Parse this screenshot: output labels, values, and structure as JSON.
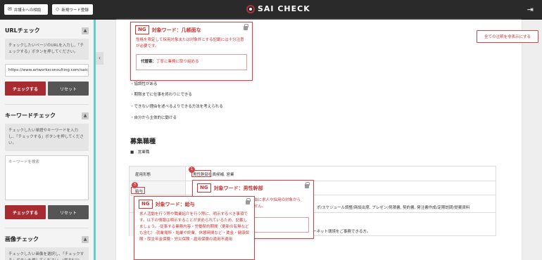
{
  "topbar": {
    "consult_label": "弁護士への相談",
    "new_word_label": "新規ワード登録",
    "logo_text": "SAI CHECK",
    "consult_icon": "mail-icon",
    "new_word_icon": "tag-icon",
    "right_icon": "export-icon"
  },
  "sidebar": {
    "url_check": {
      "title": "URLチェック",
      "hint": "チェックしたいページのURLを入力し、「チェックする」ボタンを押してください。",
      "url_value": "https://www.artworksconsulting.com/saichec",
      "check_label": "チェックする",
      "reset_label": "リセット"
    },
    "keyword_check": {
      "title": "キーワードチェック",
      "hint": "チェックしたい単語やキーワードを入力し、「チェックする」ボタンを押してください。",
      "placeholder": "キーワードを検索",
      "check_label": "チェックする",
      "reset_label": "リセット"
    },
    "image_check": {
      "title": "画像チェック",
      "hint": "チェックしたい画像を選択し、「チェックする」ボタンを押してください。(最大5つ)"
    },
    "collapse_glyph": "▲",
    "toggle_glyph": "‹"
  },
  "document": {
    "bullets": [
      "・協調性がある",
      "・期限までに仕事を終わりにできる",
      "・できない理由を述べるよりできる方法を考えられる",
      "・自分から主体的に動ける"
    ],
    "section_title": "募集職種",
    "sub_bullet": "■　営業職",
    "table": {
      "row1_header": "雇用形態",
      "row1_value": "男性幹部社員候補, 営業",
      "row2_header": "給与",
      "row3_value": "ポ/スケジュール調整/商談出席, プレゼン/見積書, 契約書, 発注書作成/定期訪問/提案資料",
      "row4_value": "ーネット環境をご事務できる方。"
    },
    "toggle_notes_label": "全ての注釈を非表示にする"
  },
  "popups": {
    "p1": {
      "badge": "NG",
      "word": "対象ワード：几帳面な",
      "desc": "性格を限定して採用対象または対象外とする記載には十分注意が必要です。",
      "alt_label": "代替案：",
      "alt_text": "丁寧に業務に取り組める"
    },
    "p2": {
      "number": "1",
      "badge": "NG",
      "word": "対象ワード：男性幹部",
      "desc_fragment": "由に求人や採用の対象から",
      "desc_fragment2": "せん。"
    },
    "p3": {
      "number": "3",
      "badge": "NG",
      "word": "対象ワード：給与",
      "desc": "求人活動を行う際や職業紹介を行う際に、明示するべき事項です。以下の情報は明示することが求められているため、記載しましょう。-従事する業務内容・労働契約期間（更新の有無なども含む）-就業場所・始業や終業、休憩時間など・賃金・健康保険・厚生年金保険・労災保険・雇用保険の適用不適用"
    }
  }
}
